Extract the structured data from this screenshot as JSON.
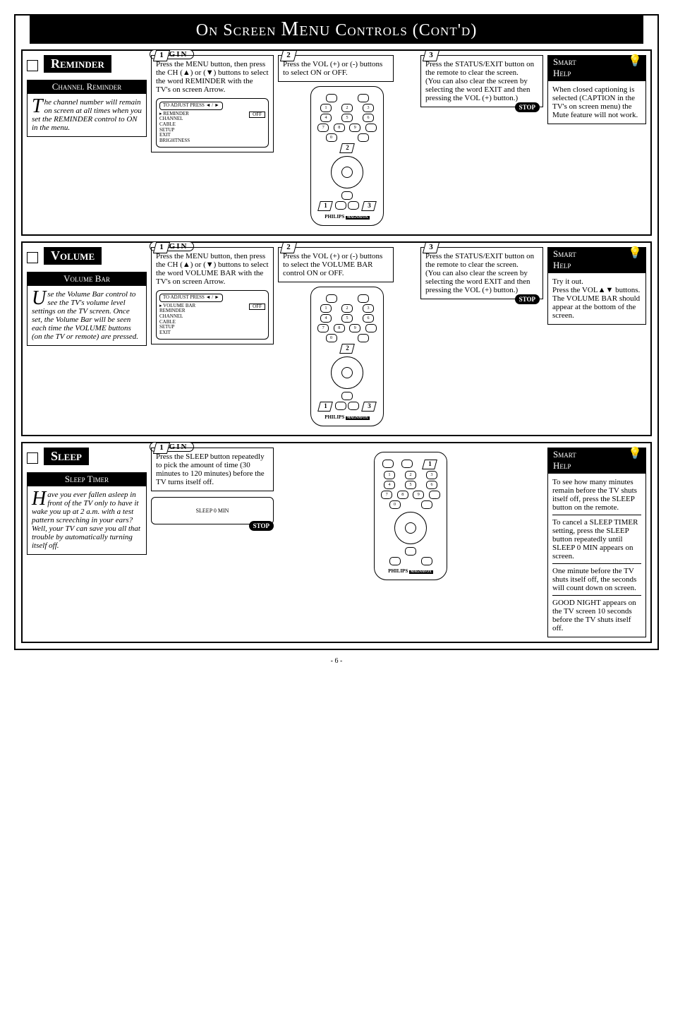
{
  "page_title_a": "On Screen ",
  "page_title_b": "Menu",
  "page_title_c": " Controls (Cont'd)",
  "footer": "- 6 -",
  "begin": "BEGIN",
  "stop": "STOP",
  "remote_brand": "PHILIPS",
  "remote_sub": "MAGNAVOX",
  "reminder": {
    "label": "Reminder",
    "sub": "Channel Reminder",
    "intro_cap": "T",
    "intro": "he channel number will remain on screen at all times when you set the REMINDER control to ON in the menu.",
    "step1": "Press the MENU button, then press the CH (▲) or (▼) buttons to select the word REMINDER with the TV's on screen Arrow.",
    "step2": "Press the VOL (+) or (-) buttons to select ON or OFF.",
    "step3": "Press the STATUS/EXIT button on the remote to clear the screen.\n(You can also clear the screen by selecting the word EXIT and then pressing the VOL (+) button.)",
    "osd_hint": "TO ADJUST PRESS ◄ / ►",
    "osd_items": [
      "REMINDER",
      "CHANNEL",
      "CABLE",
      "SETUP",
      "EXIT",
      "BRIGHTNESS"
    ],
    "osd_off": "OFF",
    "smart_a": "Smart",
    "smart_b": "Help",
    "help": "When closed captioning is selected (CAPTION in the TV's on screen menu) the Mute feature will not work."
  },
  "volume": {
    "label": "Volume",
    "sub": "Volume Bar",
    "intro_cap": "U",
    "intro": "se the Volume Bar control to see the TV's volume level settings on the TV screen. Once set, the Volume Bar will be seen each time the VOLUME buttons (on the TV or remote) are pressed.",
    "step1": "Press the MENU button, then press the CH (▲) or (▼) buttons to select the word VOLUME BAR with the TV's on screen Arrow.",
    "step2": "Press the VOL (+) or (-) buttons to select the VOLUME BAR control ON or OFF.",
    "step3": "Press the STATUS/EXIT button on the remote to clear the screen.\n(You can also clear the screen by selecting the word EXIT and then pressing the VOL (+) button.)",
    "osd_hint": "TO ADJUST PRESS ◄ / ►",
    "osd_items": [
      "VOLUME BAR",
      "REMINDER",
      "CHANNEL",
      "CABLE",
      "SETUP",
      "EXIT"
    ],
    "osd_off": "OFF",
    "smart_a": "Smart",
    "smart_b": "Help",
    "help": "Try it out.\nPress the VOL▲▼ buttons. The VOLUME BAR should appear at the bottom of the screen."
  },
  "sleep": {
    "label": "Sleep",
    "sub": "Sleep Timer",
    "intro_cap": "H",
    "intro": "ave you ever fallen asleep in front of the TV only to have it wake you up at 2 a.m. with a test pattern screeching in your ears? Well, your TV can save you all that trouble by automatically turning itself off.",
    "step1": "Press the SLEEP button repeatedly to pick the amount of time (30 minutes to 120 minutes) before the TV turns itself off.",
    "osd_text": "SLEEP   0   MIN",
    "smart_a": "Smart",
    "smart_b": "Help",
    "help1": "To see how many minutes remain before the TV shuts itself off, press the SLEEP button on the remote.",
    "help2": "To cancel a SLEEP TIMER setting, press the SLEEP button repeatedly until SLEEP 0 MIN appears on screen.",
    "help3": "One minute before the TV shuts itself off, the seconds will count down on screen.",
    "help4": "GOOD NIGHT appears on the TV screen 10 seconds before the TV shuts itself off."
  }
}
